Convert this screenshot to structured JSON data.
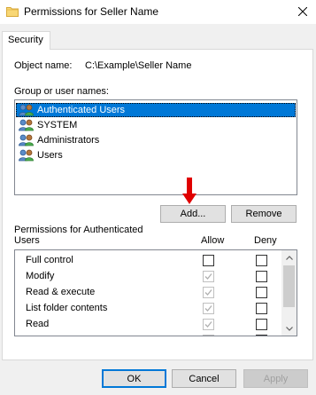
{
  "window": {
    "title": "Permissions for Seller Name",
    "icon": "folder-icon"
  },
  "tabs": [
    {
      "label": "Security",
      "active": true
    }
  ],
  "object": {
    "label": "Object name:",
    "value": "C:\\Example\\Seller Name"
  },
  "groups": {
    "label": "Group or user names:",
    "items": [
      {
        "label": "Authenticated Users",
        "selected": true,
        "icon": "users-icon"
      },
      {
        "label": "SYSTEM",
        "selected": false,
        "icon": "users-icon"
      },
      {
        "label": "Administrators",
        "selected": false,
        "icon": "users-icon"
      },
      {
        "label": "Users",
        "selected": false,
        "icon": "users-icon"
      }
    ],
    "add_label": "Add...",
    "remove_label": "Remove"
  },
  "permissions": {
    "label": "Permissions for Authenticated Users",
    "allow_header": "Allow",
    "deny_header": "Deny",
    "rows": [
      {
        "name": "Full control",
        "allow": false,
        "allow_disabled": false,
        "deny": false
      },
      {
        "name": "Modify",
        "allow": true,
        "allow_disabled": true,
        "deny": false
      },
      {
        "name": "Read & execute",
        "allow": true,
        "allow_disabled": true,
        "deny": false
      },
      {
        "name": "List folder contents",
        "allow": true,
        "allow_disabled": true,
        "deny": false
      },
      {
        "name": "Read",
        "allow": true,
        "allow_disabled": true,
        "deny": false
      }
    ]
  },
  "footer": {
    "ok_label": "OK",
    "cancel_label": "Cancel",
    "apply_label": "Apply"
  },
  "colors": {
    "selection": "#0078d7",
    "annotation_arrow": "#e00000"
  }
}
